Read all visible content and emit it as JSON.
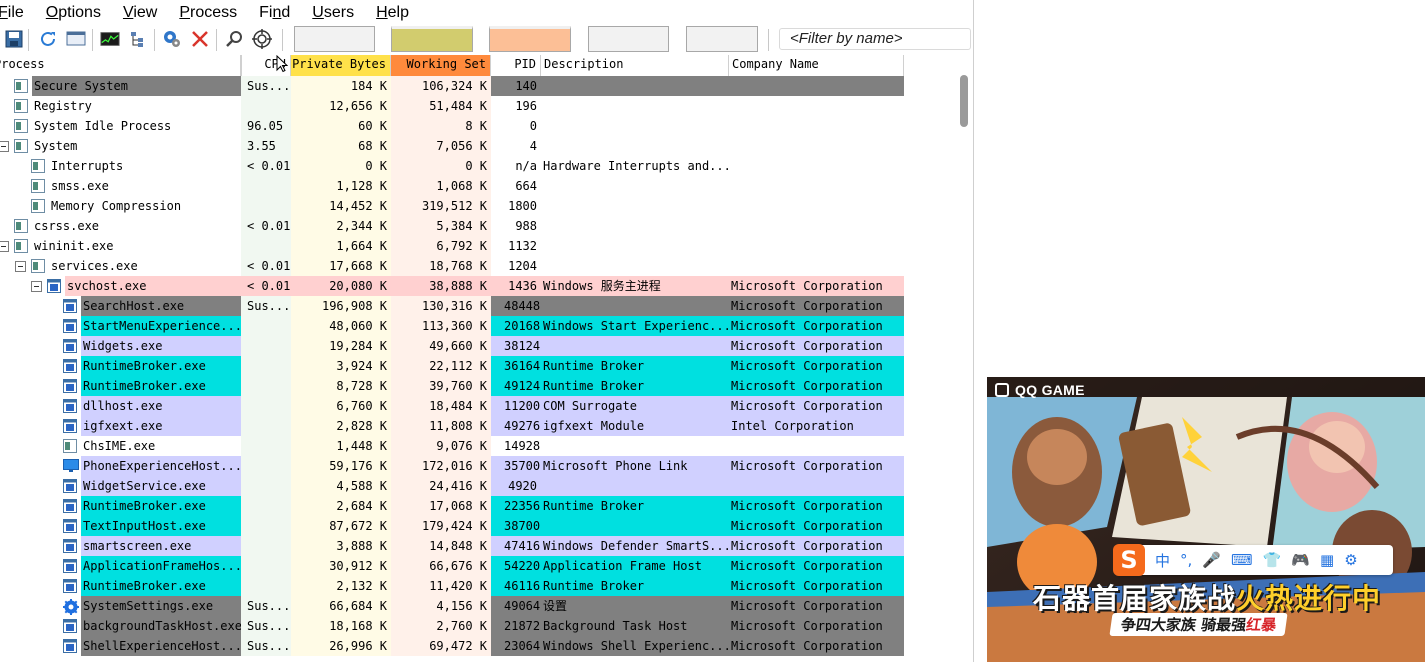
{
  "menu": [
    {
      "label": "File",
      "key": "F"
    },
    {
      "label": "Options",
      "key": "O"
    },
    {
      "label": "View",
      "key": "V"
    },
    {
      "label": "Process",
      "key": "P"
    },
    {
      "label": "Find",
      "key": "n"
    },
    {
      "label": "Users",
      "key": "U"
    },
    {
      "label": "Help",
      "key": "H"
    }
  ],
  "filter": {
    "placeholder": "<Filter by name>"
  },
  "colors": {
    "services": "#d0d0ff",
    "own_user": "#00e0e0",
    "suspended": "#808080",
    "highlight": "#ffd0d0",
    "private_bytes_col": "#fffbe6",
    "working_set_col": "#fff1ea",
    "cpu_col": "#f1f8f1",
    "private_bytes_hdr": "#ffe14a",
    "working_set_hdr": "#ff8a3c"
  },
  "columns": [
    {
      "key": "process",
      "label": "Process"
    },
    {
      "key": "cpu",
      "label": "CPU"
    },
    {
      "key": "private_bytes",
      "label": "Private Bytes"
    },
    {
      "key": "working_set",
      "label": "Working Set"
    },
    {
      "key": "pid",
      "label": "PID"
    },
    {
      "key": "description",
      "label": "Description"
    },
    {
      "key": "company",
      "label": "Company Name"
    }
  ],
  "processes": [
    {
      "name": "Secure System",
      "indent": 1,
      "icon": "window-icon",
      "tree": "",
      "cpu": "Sus...",
      "private": "184 K",
      "working": "106,324 K",
      "pid": "140",
      "desc": "",
      "company": "",
      "style": "suspended"
    },
    {
      "name": "Registry",
      "indent": 1,
      "icon": "window-icon",
      "tree": "",
      "cpu": "",
      "private": "12,656 K",
      "working": "51,484 K",
      "pid": "196",
      "desc": "",
      "company": "",
      "style": ""
    },
    {
      "name": "System Idle Process",
      "indent": 1,
      "icon": "window-icon",
      "tree": "",
      "cpu": "96.05",
      "private": "60 K",
      "working": "8 K",
      "pid": "0",
      "desc": "",
      "company": "",
      "style": ""
    },
    {
      "name": "System",
      "indent": 1,
      "icon": "window-icon",
      "tree": "minus",
      "cpu": "3.55",
      "private": "68 K",
      "working": "7,056 K",
      "pid": "4",
      "desc": "",
      "company": "",
      "style": ""
    },
    {
      "name": "Interrupts",
      "indent": 2,
      "icon": "window-icon",
      "tree": "",
      "cpu": "< 0.01",
      "private": "0 K",
      "working": "0 K",
      "pid": "n/a",
      "desc": "Hardware Interrupts and...",
      "company": "",
      "style": ""
    },
    {
      "name": "smss.exe",
      "indent": 2,
      "icon": "window-icon",
      "tree": "",
      "cpu": "",
      "private": "1,128 K",
      "working": "1,068 K",
      "pid": "664",
      "desc": "",
      "company": "",
      "style": ""
    },
    {
      "name": "Memory Compression",
      "indent": 2,
      "icon": "window-icon",
      "tree": "",
      "cpu": "",
      "private": "14,452 K",
      "working": "319,512 K",
      "pid": "1800",
      "desc": "",
      "company": "",
      "style": ""
    },
    {
      "name": "csrss.exe",
      "indent": 1,
      "icon": "window-icon",
      "tree": "",
      "cpu": "< 0.01",
      "private": "2,344 K",
      "working": "5,384 K",
      "pid": "988",
      "desc": "",
      "company": "",
      "style": ""
    },
    {
      "name": "wininit.exe",
      "indent": 1,
      "icon": "window-icon",
      "tree": "minus",
      "cpu": "",
      "private": "1,664 K",
      "working": "6,792 K",
      "pid": "1132",
      "desc": "",
      "company": "",
      "style": ""
    },
    {
      "name": "services.exe",
      "indent": 2,
      "icon": "window-icon",
      "tree": "minus",
      "cpu": "< 0.01",
      "private": "17,668 K",
      "working": "18,768 K",
      "pid": "1204",
      "desc": "",
      "company": "",
      "style": ""
    },
    {
      "name": "svchost.exe",
      "indent": 3,
      "icon": "app-icon",
      "tree": "minus",
      "cpu": "< 0.01",
      "private": "20,080 K",
      "working": "38,888 K",
      "pid": "1436",
      "desc": "Windows 服务主进程",
      "company": "Microsoft Corporation",
      "style": "highlight"
    },
    {
      "name": "SearchHost.exe",
      "indent": 4,
      "icon": "app-icon",
      "tree": "",
      "cpu": "Sus...",
      "private": "196,908 K",
      "working": "130,316 K",
      "pid": "48448",
      "desc": "",
      "company": "Microsoft Corporation",
      "style": "suspended"
    },
    {
      "name": "StartMenuExperience...",
      "indent": 4,
      "icon": "app-icon",
      "tree": "",
      "cpu": "",
      "private": "48,060 K",
      "working": "113,360 K",
      "pid": "20168",
      "desc": "Windows Start Experienc...",
      "company": "Microsoft Corporation",
      "style": "own_user"
    },
    {
      "name": "Widgets.exe",
      "indent": 4,
      "icon": "app-icon",
      "tree": "",
      "cpu": "",
      "private": "19,284 K",
      "working": "49,660 K",
      "pid": "38124",
      "desc": "",
      "company": "Microsoft Corporation",
      "style": "services"
    },
    {
      "name": "RuntimeBroker.exe",
      "indent": 4,
      "icon": "app-icon",
      "tree": "",
      "cpu": "",
      "private": "3,924 K",
      "working": "22,112 K",
      "pid": "36164",
      "desc": "Runtime Broker",
      "company": "Microsoft Corporation",
      "style": "own_user"
    },
    {
      "name": "RuntimeBroker.exe",
      "indent": 4,
      "icon": "app-icon",
      "tree": "",
      "cpu": "",
      "private": "8,728 K",
      "working": "39,760 K",
      "pid": "49124",
      "desc": "Runtime Broker",
      "company": "Microsoft Corporation",
      "style": "own_user"
    },
    {
      "name": "dllhost.exe",
      "indent": 4,
      "icon": "app-icon",
      "tree": "",
      "cpu": "",
      "private": "6,760 K",
      "working": "18,484 K",
      "pid": "11200",
      "desc": "COM Surrogate",
      "company": "Microsoft Corporation",
      "style": "services"
    },
    {
      "name": "igfxext.exe",
      "indent": 4,
      "icon": "app-icon",
      "tree": "",
      "cpu": "",
      "private": "2,828 K",
      "working": "11,808 K",
      "pid": "49276",
      "desc": "igfxext Module",
      "company": "Intel Corporation",
      "style": "services"
    },
    {
      "name": "ChsIME.exe",
      "indent": 4,
      "icon": "window-icon",
      "tree": "",
      "cpu": "",
      "private": "1,448 K",
      "working": "9,076 K",
      "pid": "14928",
      "desc": "",
      "company": "",
      "style": ""
    },
    {
      "name": "PhoneExperienceHost...",
      "indent": 4,
      "icon": "monitor-icon",
      "tree": "",
      "cpu": "",
      "private": "59,176 K",
      "working": "172,016 K",
      "pid": "35700",
      "desc": "Microsoft Phone Link",
      "company": "Microsoft Corporation",
      "style": "services"
    },
    {
      "name": "WidgetService.exe",
      "indent": 4,
      "icon": "app-icon",
      "tree": "",
      "cpu": "",
      "private": "4,588 K",
      "working": "24,416 K",
      "pid": "4920",
      "desc": "",
      "company": "",
      "style": "services"
    },
    {
      "name": "RuntimeBroker.exe",
      "indent": 4,
      "icon": "app-icon",
      "tree": "",
      "cpu": "",
      "private": "2,684 K",
      "working": "17,068 K",
      "pid": "22356",
      "desc": "Runtime Broker",
      "company": "Microsoft Corporation",
      "style": "own_user"
    },
    {
      "name": "TextInputHost.exe",
      "indent": 4,
      "icon": "app-icon",
      "tree": "",
      "cpu": "",
      "private": "87,672 K",
      "working": "179,424 K",
      "pid": "38700",
      "desc": "",
      "company": "Microsoft Corporation",
      "style": "own_user"
    },
    {
      "name": "smartscreen.exe",
      "indent": 4,
      "icon": "app-icon",
      "tree": "",
      "cpu": "",
      "private": "3,888 K",
      "working": "14,848 K",
      "pid": "47416",
      "desc": "Windows Defender SmartS...",
      "company": "Microsoft Corporation",
      "style": "services"
    },
    {
      "name": "ApplicationFrameHos...",
      "indent": 4,
      "icon": "app-icon",
      "tree": "",
      "cpu": "",
      "private": "30,912 K",
      "working": "66,676 K",
      "pid": "54220",
      "desc": "Application Frame Host",
      "company": "Microsoft Corporation",
      "style": "own_user"
    },
    {
      "name": "RuntimeBroker.exe",
      "indent": 4,
      "icon": "app-icon",
      "tree": "",
      "cpu": "",
      "private": "2,132 K",
      "working": "11,420 K",
      "pid": "46116",
      "desc": "Runtime Broker",
      "company": "Microsoft Corporation",
      "style": "own_user"
    },
    {
      "name": "SystemSettings.exe",
      "indent": 4,
      "icon": "gear-icon",
      "tree": "",
      "cpu": "Sus...",
      "private": "66,684 K",
      "working": "4,156 K",
      "pid": "49064",
      "desc": "设置",
      "company": "Microsoft Corporation",
      "style": "suspended"
    },
    {
      "name": "backgroundTaskHost.exe",
      "indent": 4,
      "icon": "app-icon",
      "tree": "",
      "cpu": "Sus...",
      "private": "18,168 K",
      "working": "2,760 K",
      "pid": "21872",
      "desc": "Background Task Host",
      "company": "Microsoft Corporation",
      "style": "suspended"
    },
    {
      "name": "ShellExperienceHost...",
      "indent": 4,
      "icon": "app-icon",
      "tree": "",
      "cpu": "Sus...",
      "private": "26,996 K",
      "working": "69,472 K",
      "pid": "23064",
      "desc": "Windows Shell Experienc...",
      "company": "Microsoft Corporation",
      "style": "suspended"
    }
  ],
  "ad": {
    "logo": "QQ GAME",
    "ime_logo": "S",
    "ime_items": [
      "中",
      "°,",
      "🎤",
      "⌨",
      "👕",
      "🎮",
      "▦",
      "⚙"
    ],
    "headline_a": "石器首届家族战",
    "headline_b": "火热进行中",
    "sub_a": "争四大家族 骑最强",
    "sub_b": "红暴"
  }
}
